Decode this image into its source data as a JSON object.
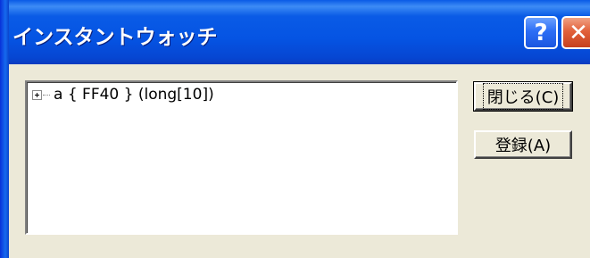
{
  "window": {
    "title": "インスタントウォッチ"
  },
  "titlebar_buttons": {
    "help_label": "?",
    "close_label": "✕"
  },
  "tree": {
    "items": [
      {
        "label": "a  { FF40 } (long[10])",
        "expanded": false
      }
    ]
  },
  "buttons": {
    "close_label": "閉じる(C)",
    "register_label": "登録(A)"
  }
}
